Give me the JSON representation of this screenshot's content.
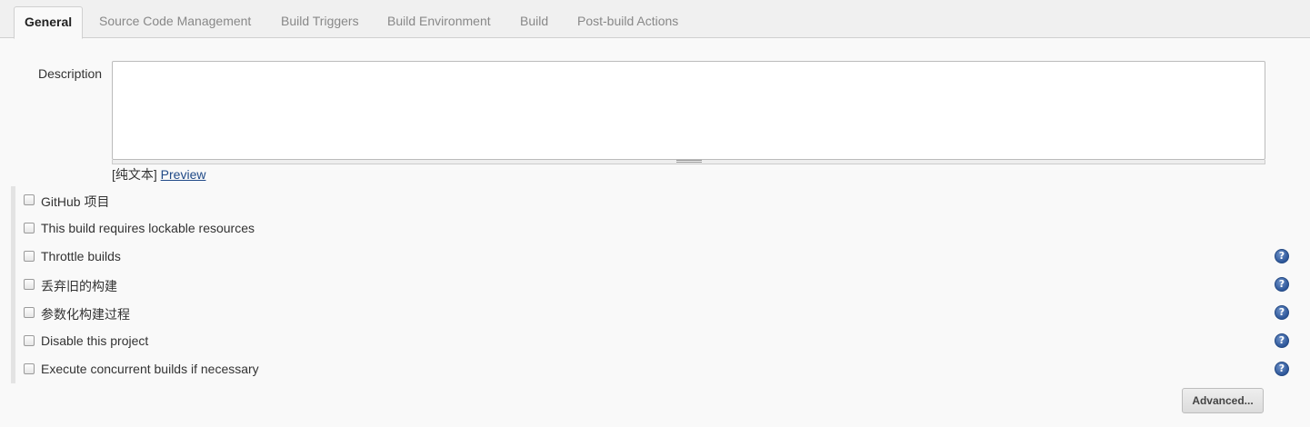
{
  "tabs": [
    {
      "label": "General",
      "active": true
    },
    {
      "label": "Source Code Management",
      "active": false
    },
    {
      "label": "Build Triggers",
      "active": false
    },
    {
      "label": "Build Environment",
      "active": false
    },
    {
      "label": "Build",
      "active": false
    },
    {
      "label": "Post-build Actions",
      "active": false
    }
  ],
  "description": {
    "label": "Description",
    "value": "",
    "format_label": "[纯文本]",
    "preview_link": "Preview"
  },
  "options": [
    {
      "label": "GitHub 项目",
      "checked": false,
      "has_help": false
    },
    {
      "label": "This build requires lockable resources",
      "checked": false,
      "has_help": false
    },
    {
      "label": "Throttle builds",
      "checked": false,
      "has_help": true
    },
    {
      "label": "丢弃旧的构建",
      "checked": false,
      "has_help": true
    },
    {
      "label": "参数化构建过程",
      "checked": false,
      "has_help": true
    },
    {
      "label": "Disable this project",
      "checked": false,
      "has_help": true
    },
    {
      "label": "Execute concurrent builds if necessary",
      "checked": false,
      "has_help": true
    }
  ],
  "help_icon_glyph": "?",
  "advanced_button": "Advanced...",
  "colors": {
    "link": "#204a87",
    "help_icon": "#2d5699"
  }
}
